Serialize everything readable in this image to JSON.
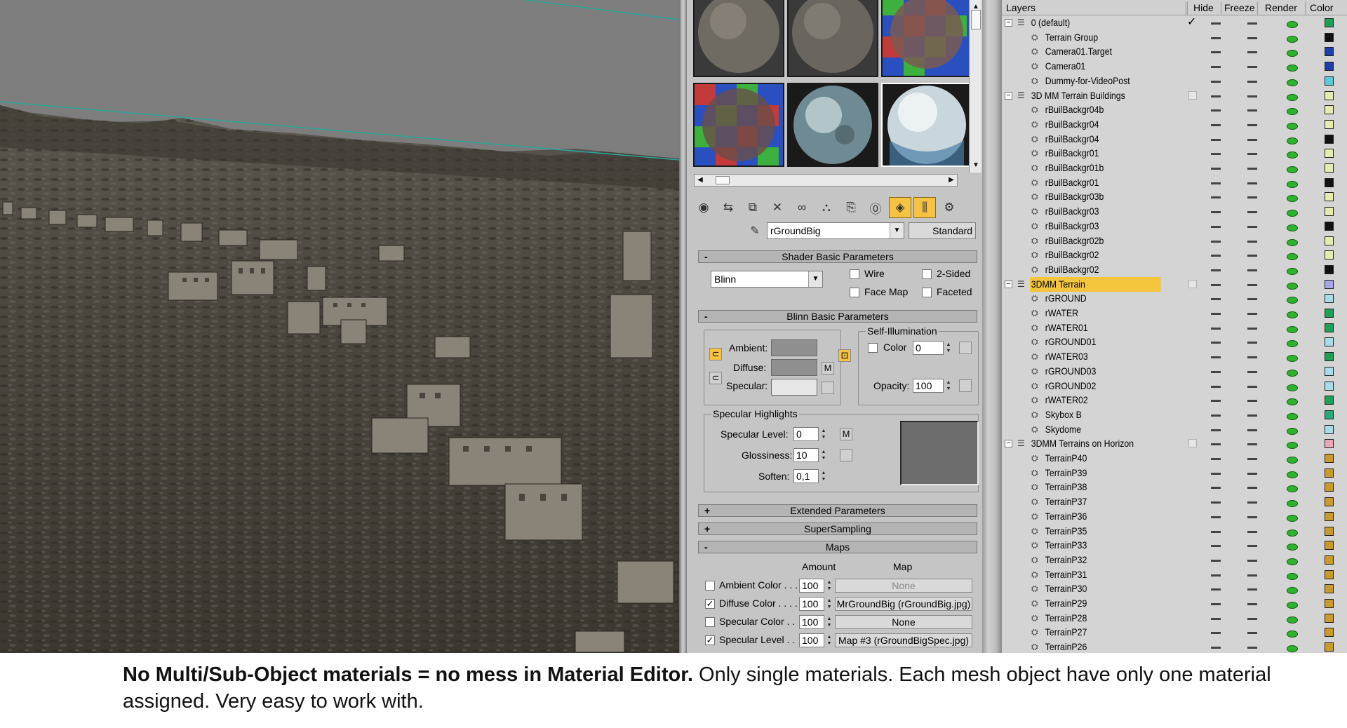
{
  "caption": {
    "bold": "No Multi/Sub-Object materials = no mess in Material Editor.",
    "rest": " Only single materials. Each mesh object have only one material assigned. Very easy to work with."
  },
  "material_editor": {
    "material_name": "rGroundBig",
    "material_type": "Standard",
    "shader_basic": {
      "title": "Shader Basic Parameters",
      "shader": "Blinn",
      "wire": "Wire",
      "two_sided": "2-Sided",
      "face_map": "Face Map",
      "faceted": "Faceted"
    },
    "blinn_basic": {
      "title": "Blinn Basic Parameters",
      "ambient": "Ambient:",
      "diffuse": "Diffuse:",
      "specular": "Specular:",
      "m": "M",
      "self_illum": "Self-Illumination",
      "color_label": "Color",
      "color_value": "0",
      "opacity_label": "Opacity:",
      "opacity_value": "100",
      "ambient_color": "#8f8f8f",
      "diffuse_color": "#8f8f8f",
      "specular_color": "#e6e6e6"
    },
    "specular_highlights": {
      "title": "Specular Highlights",
      "level_label": "Specular Level:",
      "level_value": "0",
      "gloss_label": "Glossiness:",
      "gloss_value": "10",
      "soften_label": "Soften:",
      "soften_value": "0,1",
      "m": "M"
    },
    "rollouts": {
      "extended": "Extended Parameters",
      "supersampling": "SuperSampling",
      "maps": "Maps"
    },
    "maps": {
      "amount_header": "Amount",
      "map_header": "Map",
      "rows": [
        {
          "label": "Ambient Color . . .",
          "checked": false,
          "amount": "100",
          "map": "None"
        },
        {
          "label": "Diffuse Color . . . .",
          "checked": true,
          "amount": "100",
          "map": "MrGroundBig (rGroundBig.jpg)"
        },
        {
          "label": "Specular Color . .",
          "checked": false,
          "amount": "100",
          "map": "None"
        },
        {
          "label": "Specular Level . .",
          "checked": true,
          "amount": "100",
          "map": "Map #3 (rGroundBigSpec.jpg)"
        }
      ]
    }
  },
  "layers": {
    "headers": {
      "layers": "Layers",
      "hide": "Hide",
      "freeze": "Freeze",
      "render": "Render",
      "color": "Color"
    },
    "rows": [
      {
        "name": "0 (default)",
        "type": "layer",
        "current": true,
        "color": "#1f9e55"
      },
      {
        "name": "Terrain Group",
        "type": "object",
        "color": "#111111"
      },
      {
        "name": "Camera01.Target",
        "type": "object",
        "color": "#1c3fa8"
      },
      {
        "name": "Camera01",
        "type": "object",
        "color": "#1c3fa8"
      },
      {
        "name": "Dummy-for-VideoPost",
        "type": "object",
        "color": "#5ec9d9"
      },
      {
        "name": "3D MM Terrain Buildings",
        "type": "layer",
        "color": "#e6ecb0"
      },
      {
        "name": "rBuilBackgr04b",
        "type": "object",
        "color": "#e6ecb0"
      },
      {
        "name": "rBuilBackgr04",
        "type": "object",
        "color": "#e6ecb0"
      },
      {
        "name": "rBuilBackgr04",
        "type": "object",
        "color": "#111111"
      },
      {
        "name": "rBuilBackgr01",
        "type": "object",
        "color": "#e6ecb0"
      },
      {
        "name": "rBuilBackgr01b",
        "type": "object",
        "color": "#e6ecb0"
      },
      {
        "name": "rBuilBackgr01",
        "type": "object",
        "color": "#111111"
      },
      {
        "name": "rBuilBackgr03b",
        "type": "object",
        "color": "#e6ecb0"
      },
      {
        "name": "rBuilBackgr03",
        "type": "object",
        "color": "#e6ecb0"
      },
      {
        "name": "rBuilBackgr03",
        "type": "object",
        "color": "#111111"
      },
      {
        "name": "rBuilBackgr02b",
        "type": "object",
        "color": "#e6ecb0"
      },
      {
        "name": "rBuilBackgr02",
        "type": "object",
        "color": "#e6ecb0"
      },
      {
        "name": "rBuilBackgr02",
        "type": "object",
        "color": "#111111"
      },
      {
        "name": "3DMM Terrain",
        "type": "layer",
        "selected": true,
        "color": "#a8a8e8"
      },
      {
        "name": "rGROUND",
        "type": "object",
        "color": "#a8dce8"
      },
      {
        "name": "rWATER",
        "type": "object",
        "color": "#1f9e55"
      },
      {
        "name": "rWATER01",
        "type": "object",
        "color": "#1f9e55"
      },
      {
        "name": "rGROUND01",
        "type": "object",
        "color": "#a8dce8"
      },
      {
        "name": "rWATER03",
        "type": "object",
        "color": "#1f9e55"
      },
      {
        "name": "rGROUND03",
        "type": "object",
        "color": "#a8dce8"
      },
      {
        "name": "rGROUND02",
        "type": "object",
        "color": "#a8dce8"
      },
      {
        "name": "rWATER02",
        "type": "object",
        "color": "#1f9e55"
      },
      {
        "name": "Skybox B",
        "type": "object",
        "color": "#2aa877"
      },
      {
        "name": "Skydome",
        "type": "object",
        "color": "#a8dce8"
      },
      {
        "name": "3DMM Terrains on Horizon",
        "type": "layer",
        "color": "#e8a8b8"
      },
      {
        "name": "TerrainP40",
        "type": "object",
        "color": "#c99a2e"
      },
      {
        "name": "TerrainP39",
        "type": "object",
        "color": "#c99a2e"
      },
      {
        "name": "TerrainP38",
        "type": "object",
        "color": "#c99a2e"
      },
      {
        "name": "TerrainP37",
        "type": "object",
        "color": "#c99a2e"
      },
      {
        "name": "TerrainP36",
        "type": "object",
        "color": "#c99a2e"
      },
      {
        "name": "TerrainP35",
        "type": "object",
        "color": "#c99a2e"
      },
      {
        "name": "TerrainP33",
        "type": "object",
        "color": "#c99a2e"
      },
      {
        "name": "TerrainP32",
        "type": "object",
        "color": "#c99a2e"
      },
      {
        "name": "TerrainP31",
        "type": "object",
        "color": "#c99a2e"
      },
      {
        "name": "TerrainP30",
        "type": "object",
        "color": "#c99a2e"
      },
      {
        "name": "TerrainP29",
        "type": "object",
        "color": "#c99a2e"
      },
      {
        "name": "TerrainP28",
        "type": "object",
        "color": "#c99a2e"
      },
      {
        "name": "TerrainP27",
        "type": "object",
        "color": "#c99a2e"
      },
      {
        "name": "TerrainP26",
        "type": "object",
        "color": "#c99a2e"
      }
    ]
  }
}
